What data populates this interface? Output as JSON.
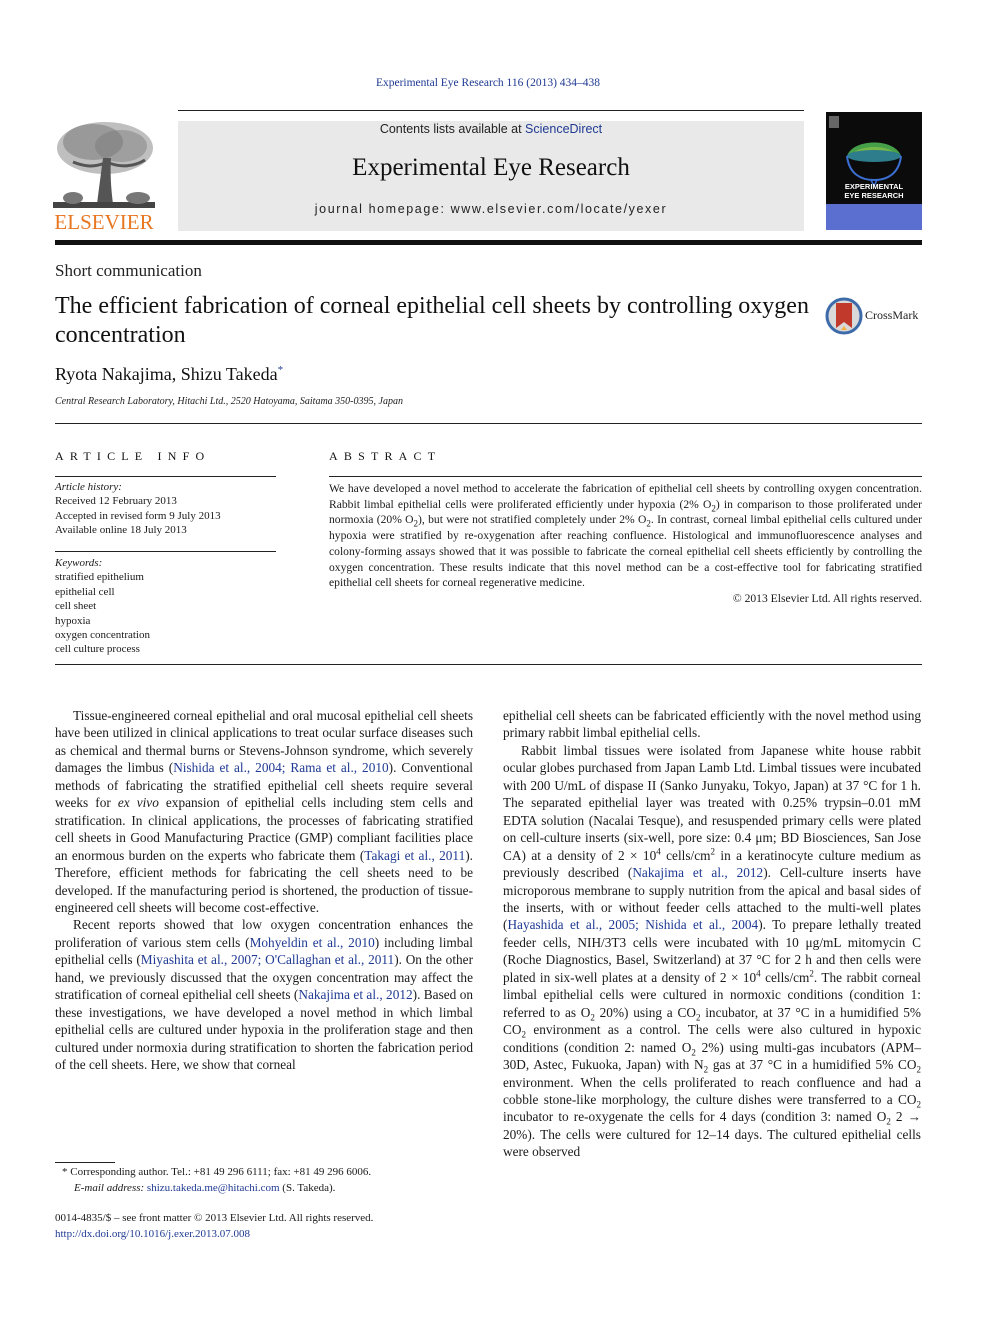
{
  "citation": "Experimental Eye Research 116 (2013) 434–438",
  "masthead": {
    "contents_prefix": "Contents lists available at ",
    "contents_link": "ScienceDirect",
    "journal_name": "Experimental Eye Research",
    "homepage": "journal homepage: www.elsevier.com/locate/yexer"
  },
  "publisher_logo": {
    "text": "ELSEVIER",
    "color": "#e87722"
  },
  "cover": {
    "title_line1": "EXPERIMENTAL",
    "title_line2": "EYE RESEARCH",
    "band_color": "#5a6fcf"
  },
  "crossmark": {
    "label": "CrossMark"
  },
  "article": {
    "section_type": "Short communication",
    "title": "The efficient fabrication of corneal epithelial cell sheets by controlling oxygen concentration",
    "authors": "Ryota Nakajima, Shizu Takeda",
    "author_mark": "*",
    "affiliation": "Central Research Laboratory, Hitachi Ltd., 2520 Hatoyama, Saitama 350-0395, Japan"
  },
  "article_info": {
    "heading": "ARTICLE INFO",
    "history_label": "Article history:",
    "history": [
      "Received 12 February 2013",
      "Accepted in revised form 9 July 2013",
      "Available online 18 July 2013"
    ],
    "keywords_label": "Keywords:",
    "keywords": [
      "stratified epithelium",
      "epithelial cell",
      "cell sheet",
      "hypoxia",
      "oxygen concentration",
      "cell culture process"
    ]
  },
  "abstract": {
    "heading": "ABSTRACT",
    "s1": "We have developed a novel method to accelerate the fabrication of epithelial cell sheets by controlling oxygen concentration. Rabbit limbal epithelial cells were proliferated efficiently under hypoxia (2% O",
    "s2": ") in comparison to those proliferated under normoxia (20% O",
    "s3": "), but were not stratified completely under 2% O",
    "s4": ". In contrast, corneal limbal epithelial cells cultured under hypoxia were stratified by re-oxygenation after reaching confluence. Histological and immunofluorescence analyses and colony-forming assays showed that it was possible to fabricate the corneal epithelial cell sheets efficiently by controlling the oxygen concentration. These results indicate that this novel method can be a cost-effective tool for fabricating stratified epithelial cell sheets for corneal regenerative medicine.",
    "sub2": "2",
    "copyright": "© 2013 Elsevier Ltd. All rights reserved."
  },
  "body": {
    "left": {
      "p1_a": "Tissue-engineered corneal epithelial and oral mucosal epithelial cell sheets have been utilized in clinical applications to treat ocular surface diseases such as chemical and thermal burns or Stevens-Johnson syndrome, which severely damages the limbus (",
      "p1_ref1": "Nishida et al., 2004; Rama et al., 2010",
      "p1_b": "). Conventional methods of fabricating the stratified epithelial cell sheets require several weeks for ",
      "p1_exvivo": "ex vivo",
      "p1_c": " expansion of epithelial cells including stem cells and stratification. In clinical applications, the processes of fabricating stratified cell sheets in Good Manufacturing Practice (GMP) compliant facilities place an enormous burden on the experts who fabricate them (",
      "p1_ref2": "Takagi et al., 2011",
      "p1_d": "). Therefore, efficient methods for fabricating the cell sheets need to be developed. If the manufacturing period is shortened, the production of tissue-engineered cell sheets will become cost-effective.",
      "p2_a": "Recent reports showed that low oxygen concentration enhances the proliferation of various stem cells (",
      "p2_ref1": "Mohyeldin et al., 2010",
      "p2_b": ") including limbal epithelial cells (",
      "p2_ref2": "Miyashita et al., 2007; O'Callaghan et al., 2011",
      "p2_c": "). On the other hand, we previously discussed that the oxygen concentration may affect the stratification of corneal epithelial cell sheets (",
      "p2_ref3": "Nakajima et al., 2012",
      "p2_d": "). Based on these investigations, we have developed a novel method in which limbal epithelial cells are cultured under hypoxia in the proliferation stage and then cultured under normoxia during stratification to shorten the fabrication period of the cell sheets. Here, we show that corneal"
    },
    "right": {
      "p1": "epithelial cell sheets can be fabricated efficiently with the novel method using primary rabbit limbal epithelial cells.",
      "p2_a": "Rabbit limbal tissues were isolated from Japanese white house rabbit ocular globes purchased from Japan Lamb Ltd. Limbal tissues were incubated with 200 U/mL of dispase II (Sanko Junyaku, Tokyo, Japan) at 37 °C for 1 h. The separated epithelial layer was treated with 0.25% trypsin–0.01 mM EDTA solution (Nacalai Tesque), and resuspended primary cells were plated on cell-culture inserts (six-well, pore size: 0.4 μm; BD Biosciences, San Jose CA) at a density of 2 × 10",
      "p2_sup4": "4",
      "p2_b": " cells/cm",
      "p2_sup2": "2",
      "p2_c": " in a keratinocyte culture medium as previously described (",
      "p2_ref1": "Nakajima et al., 2012",
      "p2_d": "). Cell-culture inserts have microporous membrane to supply nutrition from the apical and basal sides of the inserts, with or without feeder cells attached to the multi-well plates (",
      "p2_ref2": "Hayashida et al., 2005; Nishida et al., 2004",
      "p2_e": "). To prepare lethally treated feeder cells, NIH/3T3 cells were incubated with 10 μg/mL mitomycin C (Roche Diagnostics, Basel, Switzerland) at 37 °C for 2 h and then cells were plated in six-well plates at a density of 2 × 10",
      "p2_f": " cells/cm",
      "p2_g": ". The rabbit corneal limbal epithelial cells were cultured in normoxic conditions (condition 1: referred to as O",
      "p2_h": " 20%) using a CO",
      "p2_i": " incubator, at 37 °C in a humidified 5% CO",
      "p2_j": " environment as a control. The cells were also cultured in hypoxic conditions (condition 2: named O",
      "p2_k": " 2%) using multi-gas incubators (APM–30D, Astec, Fukuoka, Japan) with N",
      "p2_l": " gas at 37 °C in a humidified 5% CO",
      "p2_m": " environment. When the cells proliferated to reach confluence and had a cobble stone-like morphology, the culture dishes were transferred to a CO",
      "p2_n": " incubator to re-oxygenate the cells for 4 days (condition 3: named O",
      "p2_o": " 2 → 20%). The cells were cultured for 12–14 days. The cultured epithelial cells were observed",
      "sub2": "2"
    }
  },
  "footnote": {
    "mark": "*",
    "text": "Corresponding author. Tel.: +81 49 296 6111; fax: +81 49 296 6006.",
    "email_label": "E-mail address:",
    "email": "shizu.takeda.me@hitachi.com",
    "email_suffix": " (S. Takeda)."
  },
  "front_matter": {
    "issn_line": "0014-4835/$ – see front matter © 2013 Elsevier Ltd. All rights reserved.",
    "doi": "http://dx.doi.org/10.1016/j.exer.2013.07.008"
  },
  "colors": {
    "link": "#1f3a93",
    "elsevier_orange": "#e87722",
    "masthead_bg": "#e9e9e9"
  }
}
